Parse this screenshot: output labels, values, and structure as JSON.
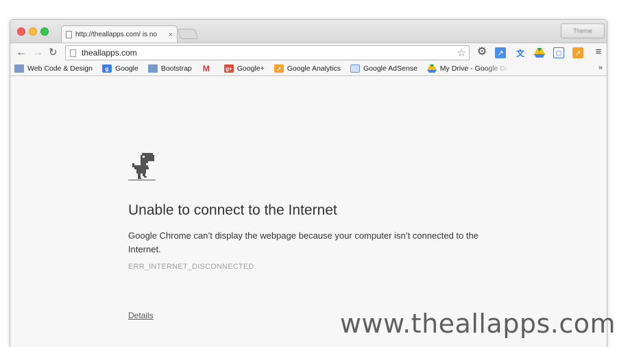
{
  "window": {
    "tab_title": "http://theallapps.com/ is no",
    "tab_close": "×",
    "profile_label": "Theme"
  },
  "toolbar": {
    "back": "←",
    "forward": "→",
    "reload": "↻",
    "url": "theallapps.com",
    "star": "☆",
    "menu": "≡"
  },
  "bookmarks": {
    "items": [
      {
        "label": "Web Code & Design",
        "icon": "folder-icon"
      },
      {
        "label": "Google",
        "icon": "google-icon"
      },
      {
        "label": "Bootstrap",
        "icon": "folder-icon"
      },
      {
        "label": "",
        "icon": "gmail-icon"
      },
      {
        "label": "Google+",
        "icon": "google-plus-icon"
      },
      {
        "label": "Google Analytics",
        "icon": "analytics-icon"
      },
      {
        "label": "Google AdSense",
        "icon": "adsense-icon"
      },
      {
        "label": "My Drive - Google Dr",
        "icon": "drive-icon"
      }
    ],
    "more": "»"
  },
  "content": {
    "title": "Unable to connect to the Internet",
    "message": "Google Chrome can’t display the webpage because your computer isn’t connected to the Internet.",
    "error_code": "ERR_INTERNET_DISCONNECTED",
    "details_link": "Details"
  },
  "watermark": "www.theallapps.com",
  "colors": {
    "close": "#fc605c",
    "minimize": "#fdbc40",
    "maximize": "#34c84a",
    "page_bg": "#f7f7f7"
  }
}
